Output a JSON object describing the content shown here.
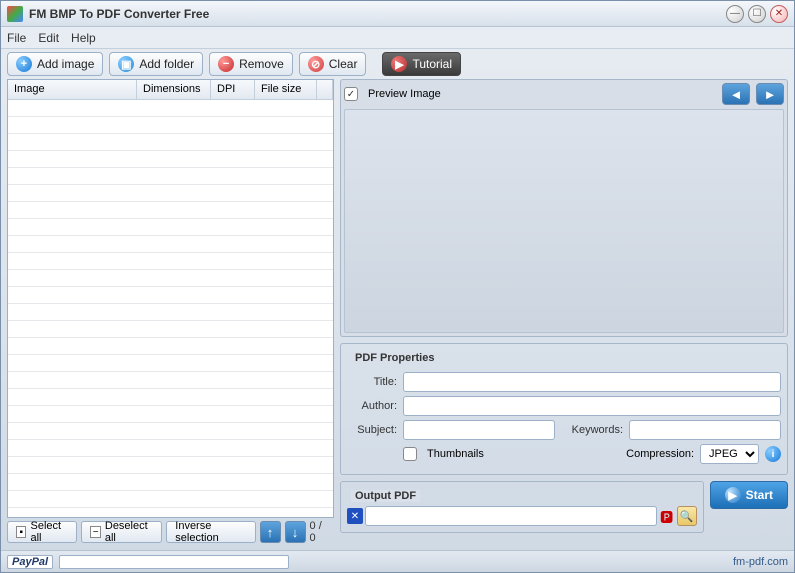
{
  "title": "FM BMP To PDF Converter Free",
  "menu": {
    "file": "File",
    "edit": "Edit",
    "help": "Help"
  },
  "toolbar": {
    "add_image": "Add image",
    "add_folder": "Add folder",
    "remove": "Remove",
    "clear": "Clear",
    "tutorial": "Tutorial"
  },
  "columns": {
    "image": "Image",
    "dimensions": "Dimensions",
    "dpi": "DPI",
    "file_size": "File size"
  },
  "bottom": {
    "select_all": "Select all",
    "deselect_all": "Deselect all",
    "inverse": "Inverse selection",
    "counter": "0 / 0"
  },
  "preview": {
    "label": "Preview Image"
  },
  "pdf_props": {
    "legend": "PDF Properties",
    "title_label": "Title:",
    "author_label": "Author:",
    "subject_label": "Subject:",
    "keywords_label": "Keywords:",
    "thumbnails_label": "Thumbnails",
    "compression_label": "Compression:",
    "compression_value": "JPEG",
    "title_value": "",
    "author_value": "",
    "subject_value": "",
    "keywords_value": ""
  },
  "output": {
    "legend": "Output PDF",
    "path": ""
  },
  "start": "Start",
  "status": {
    "paypal": "PayPal",
    "site": "fm-pdf.com"
  }
}
